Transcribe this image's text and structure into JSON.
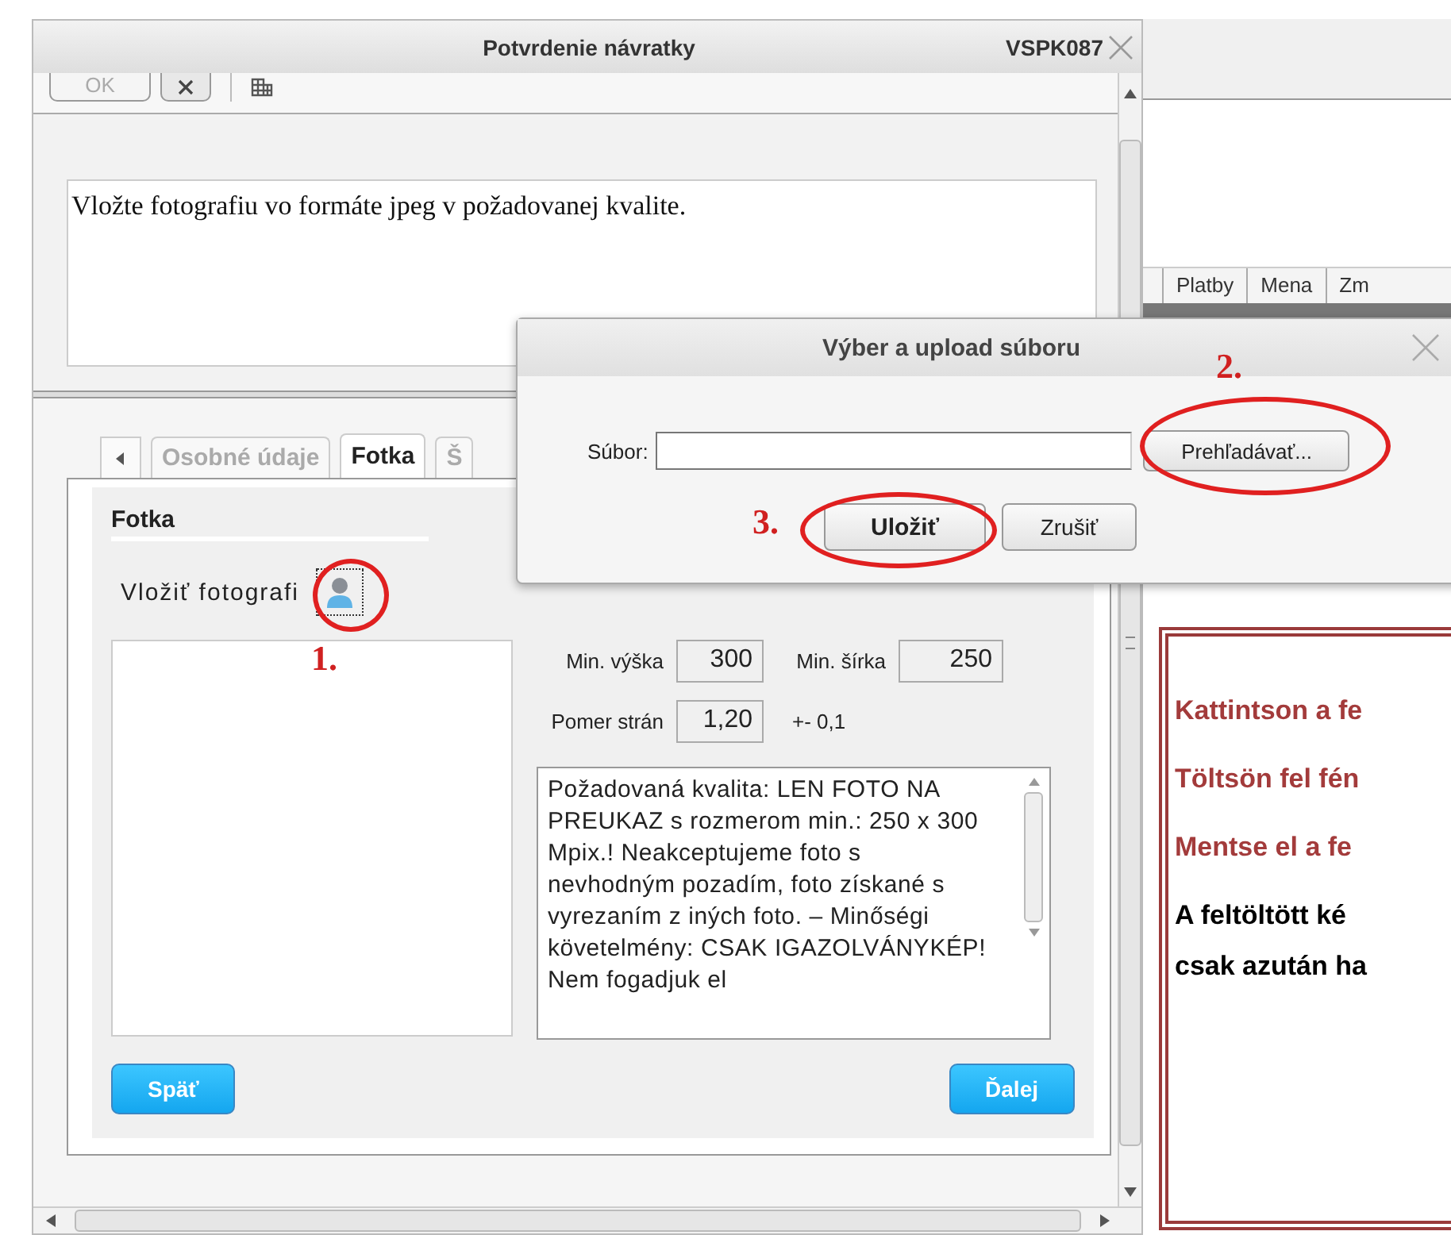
{
  "background_app": {
    "columns": [
      "Platby",
      "Mena",
      "Zm"
    ]
  },
  "main_dialog": {
    "title": "Potvrdenie návratky",
    "code": "VSPK087",
    "toolbar": {
      "ok_label": "OK",
      "ok_disabled": true
    },
    "message": "Vložte fotografiu vo formáte jpeg v požadovanej kvalite.",
    "tabs": [
      {
        "label": "Osobné údaje",
        "selected": false
      },
      {
        "label": "Fotka",
        "selected": true
      },
      {
        "label": "Š",
        "selected": false
      }
    ],
    "panel": {
      "section_title": "Fotka",
      "insert_label": "Vložiť fotografi",
      "fields": [
        {
          "label": "Min. výška",
          "value": "300"
        },
        {
          "label": "Min. šírka",
          "value": "250"
        },
        {
          "label": "Pomer strán",
          "value": "1,20",
          "note": "+- 0,1"
        }
      ],
      "requirements": "Požadovaná kvalita: LEN FOTO NA PREUKAZ s rozmerom min.: 250 x 300 Mpix.! Neakceptujeme foto s nevhodným pozadím, foto získané s vyrezaním z iných foto. – Minőségi követelmény: CSAK IGAZOLVÁNYKÉP! Nem fogadjuk el",
      "back": "Späť",
      "next": "Ďalej"
    }
  },
  "upload_dialog": {
    "title": "Výber a upload súboru",
    "file_label": "Súbor:",
    "browse": "Prehľadávať...",
    "save": "Uložiť",
    "cancel": "Zrušiť"
  },
  "instructions": [
    {
      "text": "Kattintson a fe",
      "kind": "step"
    },
    {
      "text": "Töltsön fel fén",
      "kind": "step"
    },
    {
      "text": "Mentse el a fe",
      "kind": "step"
    },
    {
      "text": "A feltöltött ké",
      "kind": "note"
    },
    {
      "text": "csak azután ha",
      "kind": "note"
    }
  ],
  "annotations": [
    "1.",
    "2.",
    "3."
  ]
}
